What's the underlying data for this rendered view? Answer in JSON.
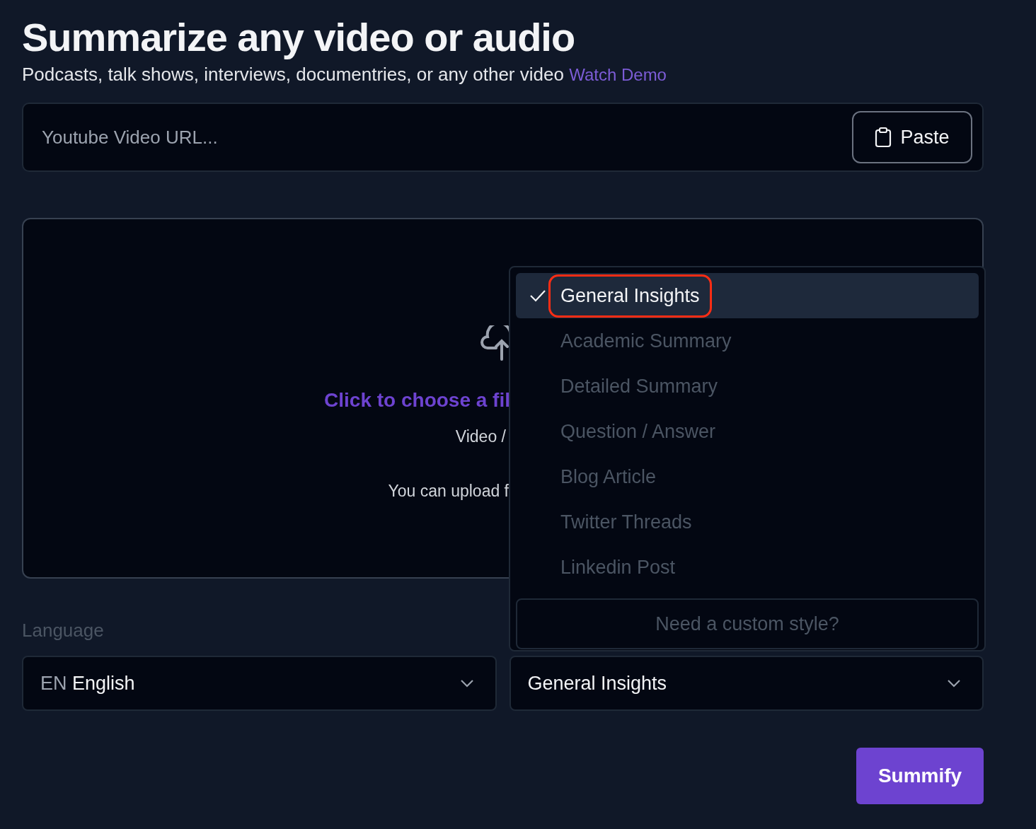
{
  "header": {
    "title": "Summarize any video or audio",
    "subtitle": "Podcasts, talk shows, interviews, documentries, or any other video",
    "demo_link": "Watch Demo"
  },
  "url_field": {
    "placeholder": "Youtube Video URL...",
    "paste_button": "Paste"
  },
  "upload": {
    "prompt": "Click to choose a fil",
    "formats": "Video /",
    "limit": "You can upload f"
  },
  "language": {
    "label": "Language",
    "code": "EN",
    "value": "English"
  },
  "style_select": {
    "value": "General Insights"
  },
  "style_menu": {
    "options": [
      {
        "label": "General Insights",
        "selected": true,
        "highlighted": true
      },
      {
        "label": "Academic Summary",
        "selected": false,
        "highlighted": false
      },
      {
        "label": "Detailed Summary",
        "selected": false,
        "highlighted": false
      },
      {
        "label": "Question / Answer",
        "selected": false,
        "highlighted": false
      },
      {
        "label": "Blog Article",
        "selected": false,
        "highlighted": false
      },
      {
        "label": "Twitter Threads",
        "selected": false,
        "highlighted": false
      },
      {
        "label": "Linkedin Post",
        "selected": false,
        "highlighted": false
      }
    ],
    "custom_button": "Need a custom style?"
  },
  "submit_button": "Summify"
}
